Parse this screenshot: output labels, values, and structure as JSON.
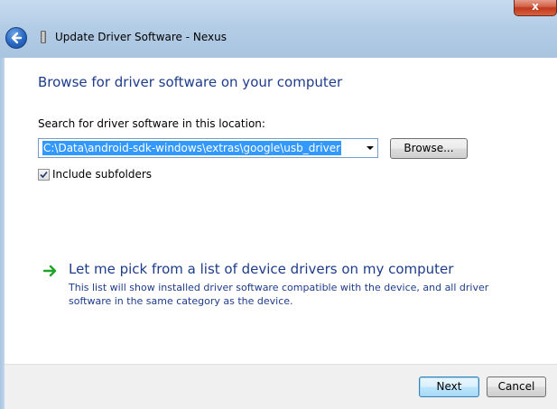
{
  "window": {
    "title": "Update Driver Software - Nexus",
    "close_glyph": "x"
  },
  "main": {
    "heading": "Browse for driver software on your computer",
    "search_label": "Search for driver software in this location:",
    "path_value": "C:\\Data\\android-sdk-windows\\extras\\google\\usb_driver",
    "browse_label": "Browse...",
    "include_subfolders_label": "Include subfolders",
    "include_subfolders_checked": true,
    "pick_title": "Let me pick from a list of device drivers on my computer",
    "pick_description": "This list will show installed driver software compatible with the device, and all driver software in the same category as the device."
  },
  "footer": {
    "next_label": "Next",
    "cancel_label": "Cancel"
  },
  "icons": {
    "back": "back-arrow-icon",
    "device": "device-icon",
    "pick_arrow": "green-arrow-icon",
    "checkbox": "checkmark-icon"
  },
  "colors": {
    "accent_text": "#1e3c8c",
    "selection": "#3399ff",
    "pick_arrow": "#1fa32a"
  }
}
